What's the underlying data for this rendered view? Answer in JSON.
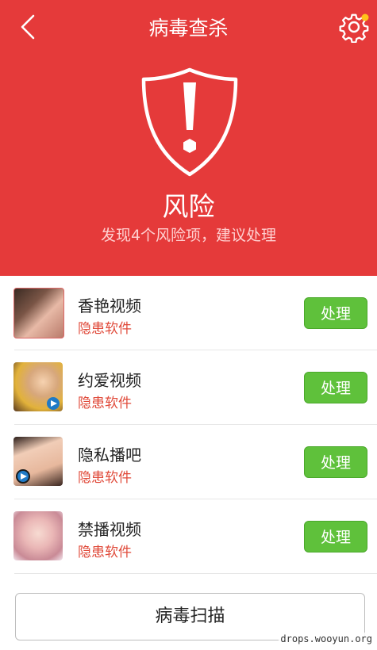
{
  "header": {
    "title": "病毒查杀",
    "accent": "#e53a3a",
    "notification_color": "#ffc21a"
  },
  "status": {
    "level": "风险",
    "summary": "发现4个风险项，建议处理"
  },
  "apps": [
    {
      "name": "香艳视频",
      "tag": "隐患软件",
      "action": "处理",
      "thumb": "portrait-photo-1"
    },
    {
      "name": "约爱视频",
      "tag": "隐患软件",
      "action": "处理",
      "thumb": "portrait-photo-2"
    },
    {
      "name": "隐私播吧",
      "tag": "隐患软件",
      "action": "处理",
      "thumb": "portrait-photo-3"
    },
    {
      "name": "禁播视频",
      "tag": "隐患软件",
      "action": "处理",
      "thumb": "portrait-photo-4"
    }
  ],
  "footer": {
    "scan_label": "病毒扫描",
    "watermark": "drops.wooyun.org"
  },
  "colors": {
    "action_button": "#5fc13b",
    "tag_text": "#e04a3a"
  }
}
